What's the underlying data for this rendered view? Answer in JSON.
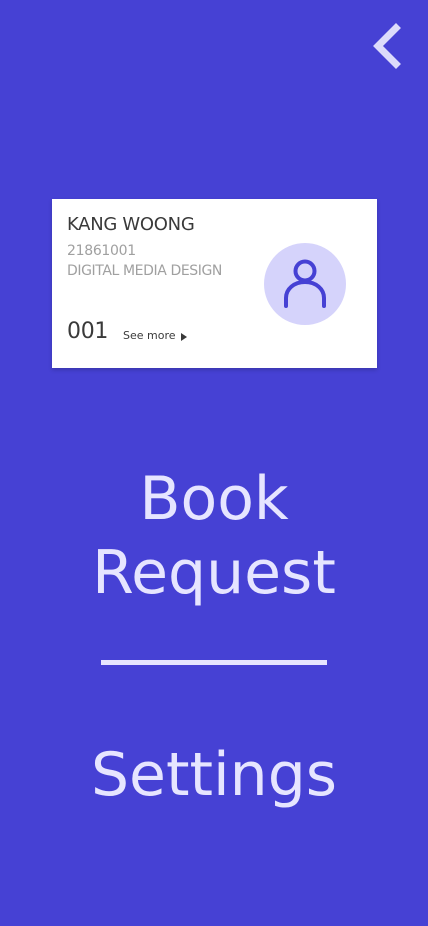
{
  "colors": {
    "background": "#4641d4",
    "card": "#ffffff",
    "avatar_bg": "#d5d3fb",
    "avatar_icon": "#4641d4",
    "menu_text": "#e6e5ff"
  },
  "header": {
    "back_icon": "chevron-left-icon"
  },
  "profile_card": {
    "name": "KANG WOONG",
    "student_id": "21861001",
    "department": "DIGITAL MEDIA DESIGN",
    "number": "001",
    "see_more_label": "See more",
    "see_more_icon": "triangle-right-icon",
    "avatar_icon": "user-icon"
  },
  "menu": {
    "book_request_line1": "Book",
    "book_request_line2": "Request",
    "settings_label": "Settings"
  }
}
